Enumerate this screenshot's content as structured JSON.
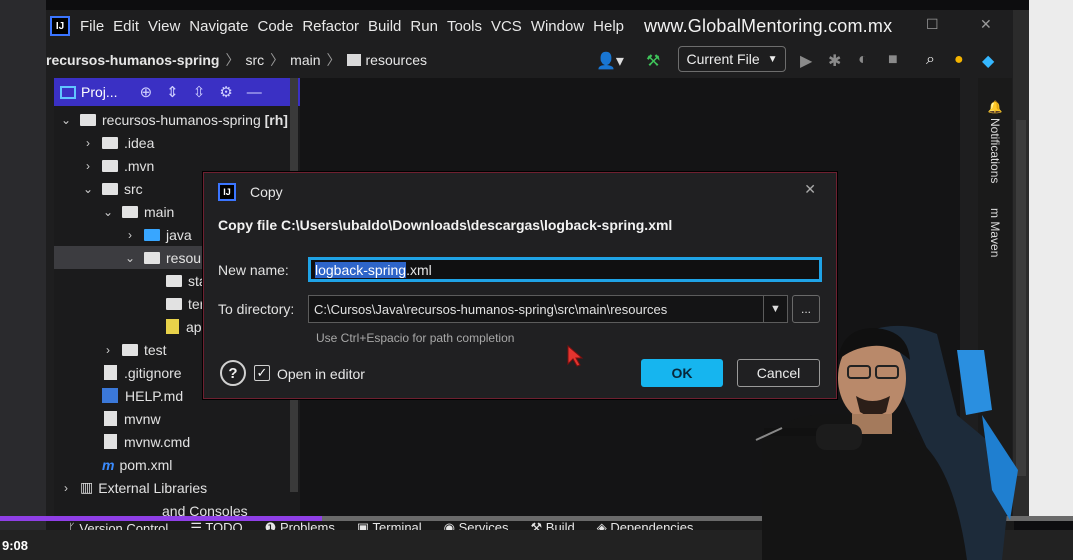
{
  "menubar": {
    "items": [
      "File",
      "Edit",
      "View",
      "Navigate",
      "Code",
      "Refactor",
      "Build",
      "Run",
      "Tools",
      "VCS",
      "Window",
      "Help"
    ],
    "watermark": "www.GlobalMentoring.com.mx"
  },
  "navbar": {
    "crumbs": [
      "recursos-humanos-spring",
      "src",
      "main",
      "resources"
    ],
    "current_file": "Current File"
  },
  "project_panel": {
    "title": "Proj...",
    "tree": [
      {
        "label": "recursos-humanos-spring",
        "badge": "[rh]"
      },
      {
        "label": ".idea"
      },
      {
        "label": ".mvn"
      },
      {
        "label": "src"
      },
      {
        "label": "main"
      },
      {
        "label": "java"
      },
      {
        "label": "resou"
      },
      {
        "label": "sta"
      },
      {
        "label": "ter"
      },
      {
        "label": "ap"
      },
      {
        "label": "test"
      },
      {
        "label": ".gitignore"
      },
      {
        "label": "HELP.md"
      },
      {
        "label": "mvnw"
      },
      {
        "label": "mvnw.cmd"
      },
      {
        "label": "pom.xml"
      },
      {
        "label": "External Libraries"
      },
      {
        "label": "and Consoles"
      }
    ]
  },
  "right_strip": {
    "notifications": "Notifications",
    "maven": "Maven"
  },
  "bottom_bar": {
    "items": [
      "Version Control",
      "TODO",
      "Problems",
      "Terminal",
      "Services",
      "Build",
      "Dependencies"
    ]
  },
  "video": {
    "timecode": "9:08",
    "progress_percent": 30
  },
  "dialog": {
    "title": "Copy",
    "heading": "Copy file C:\\Users\\ubaldo\\Downloads\\descargas\\logback-spring.xml",
    "new_name_label": "New name:",
    "new_name_selected": "logback-spring",
    "new_name_rest": ".xml",
    "to_directory_label": "To directory:",
    "to_directory_value": "C:\\Cursos\\Java\\recursos-humanos-spring\\src\\main\\resources",
    "hint": "Use Ctrl+Espacio for path completion",
    "help_label": "?",
    "open_in_editor_label": "Open in editor",
    "open_in_editor_checked": true,
    "ok_label": "OK",
    "cancel_label": "Cancel",
    "browse_label": "..."
  },
  "colors": {
    "accent_blue": "#16b5ef",
    "panel_header": "#3a30c4",
    "progress": "#8f3fe6"
  }
}
